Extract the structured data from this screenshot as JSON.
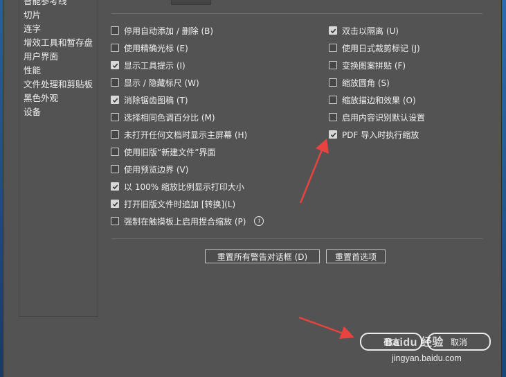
{
  "sidebar": {
    "items": [
      {
        "label": "智能参考线"
      },
      {
        "label": "切片"
      },
      {
        "label": "连字"
      },
      {
        "label": "增效工具和暂存盘"
      },
      {
        "label": "用户界面"
      },
      {
        "label": "性能"
      },
      {
        "label": "文件处理和剪贴板"
      },
      {
        "label": "黑色外观"
      },
      {
        "label": "设备"
      }
    ]
  },
  "options": {
    "left": [
      {
        "label": "停用自动添加 / 删除 (B)",
        "checked": false
      },
      {
        "label": "使用精确光标 (E)",
        "checked": false
      },
      {
        "label": "显示工具提示 (I)",
        "checked": true
      },
      {
        "label": "显示 / 隐藏标尺 (W)",
        "checked": false
      },
      {
        "label": "消除锯齿图稿 (T)",
        "checked": true
      },
      {
        "label": "选择相同色调百分比 (M)",
        "checked": false
      },
      {
        "label": "未打开任何文档时显示主屏幕 (H)",
        "checked": false
      },
      {
        "label": "使用旧版“新建文件”界面",
        "checked": false
      },
      {
        "label": "使用预览边界 (V)",
        "checked": false
      },
      {
        "label": "以 100% 缩放比例显示打印大小",
        "checked": true
      },
      {
        "label": "打开旧版文件时追加 [转换](L)",
        "checked": true
      },
      {
        "label": "强制在触摸板上启用捏合缩放 (P)",
        "checked": false
      }
    ],
    "right": [
      {
        "label": "双击以隔离 (U)",
        "checked": true
      },
      {
        "label": "使用日式裁剪标记 (J)",
        "checked": false
      },
      {
        "label": "变换图案拼贴 (F)",
        "checked": false
      },
      {
        "label": "缩放圆角 (S)",
        "checked": false
      },
      {
        "label": "缩放描边和效果 (O)",
        "checked": false
      },
      {
        "label": "启用内容识别默认设置",
        "checked": false
      },
      {
        "label": "PDF 导入时执行缩放",
        "checked": true
      }
    ]
  },
  "buttons": {
    "reset_warnings": "重置所有警告对话框 (D)",
    "reset_prefs": "重置首选项",
    "ok": "确定",
    "cancel": "取消"
  },
  "info_icon_glyph": "i",
  "watermark": {
    "logo": "Baidu 经验",
    "url": "jingyan.baidu.com"
  },
  "colors": {
    "panel": "#535353",
    "annotation_arrow": "#e8433f"
  }
}
